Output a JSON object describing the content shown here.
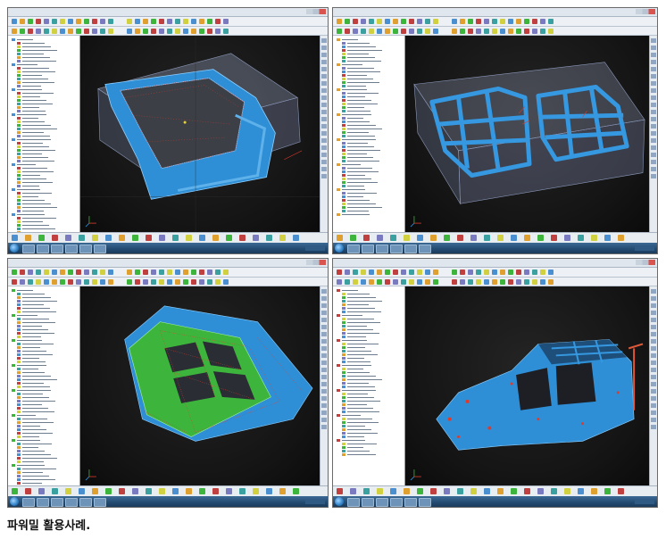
{
  "caption": "파워밀 활용사례.",
  "colors": {
    "viewport_bg": "#141414",
    "part_blue": "#2f8fd6",
    "part_green": "#3db53d",
    "toolpath_red": "#e03a2a",
    "stock_box": "#8a97b8",
    "taskbar": "#234a70"
  },
  "screenshots": [
    {
      "name": "door-inner-panel-with-stock",
      "part_color": "blue",
      "has_stock_box": true
    },
    {
      "name": "door-frames-with-stock",
      "part_color": "blue",
      "has_stock_box": true
    },
    {
      "name": "hood-inner-panel",
      "part_color": "green-blue",
      "has_stock_box": false
    },
    {
      "name": "car-body-in-white",
      "part_color": "blue",
      "has_stock_box": false
    }
  ],
  "icons": [
    "windows-start-icon",
    "folder-icon",
    "powermill-app-icon",
    "axis-triad-icon"
  ]
}
